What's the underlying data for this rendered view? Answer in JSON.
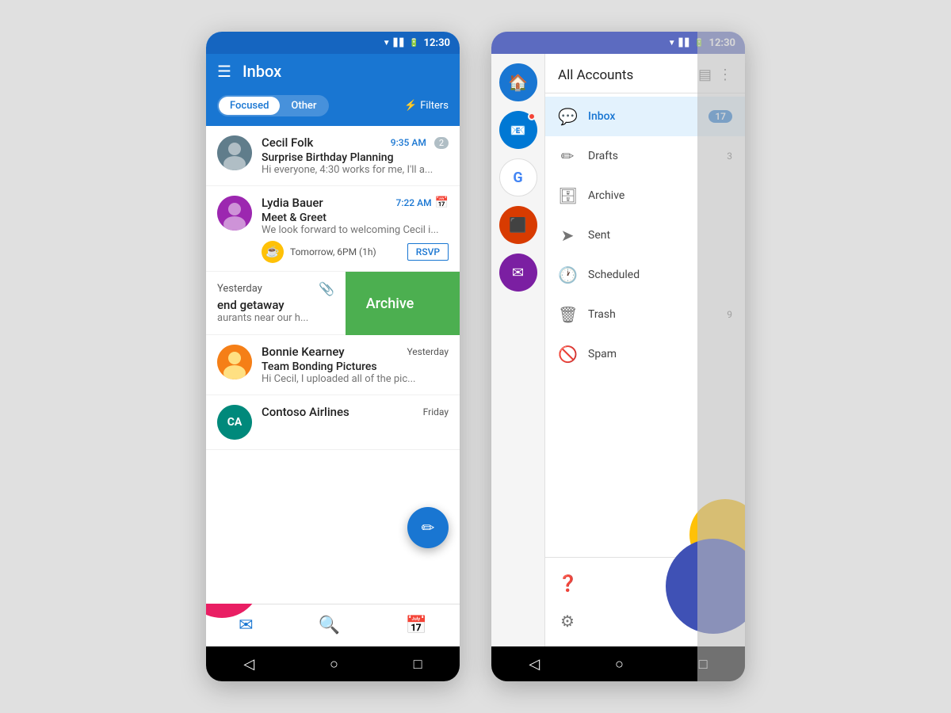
{
  "left_phone": {
    "status_bar": {
      "time": "12:30",
      "bg": "#1565C0"
    },
    "header": {
      "title": "Inbox",
      "hamburger": "☰"
    },
    "tabs": {
      "focused": "Focused",
      "other": "Other",
      "filters": "Filters"
    },
    "emails": [
      {
        "id": "email-1",
        "sender": "Cecil Folk",
        "subject": "Surprise Birthday Planning",
        "preview": "Hi everyone, 4:30 works for me, I'll a...",
        "time": "9:35 AM",
        "badge": "2",
        "avatar_color": "#607D8B",
        "has_event": false
      },
      {
        "id": "email-2",
        "sender": "Lydia Bauer",
        "subject": "Meet & Greet",
        "preview": "We look forward to welcoming Cecil i...",
        "time": "7:22 AM",
        "avatar_color": "#9C27B0",
        "has_event": true,
        "event_time": "Tomorrow, 6PM (1h)",
        "event_action": "RSVP"
      }
    ],
    "archive_item": {
      "time": "Yesterday",
      "preview": "end getaway",
      "preview2": "aurants near our h...",
      "archive_label": "Archive"
    },
    "bonnie_email": {
      "sender": "Bonnie Kearney",
      "subject": "Team Bonding Pictures",
      "preview": "Hi Cecil, I uploaded all of the pic...",
      "time": "Yesterday",
      "avatar_color": "#F57F17"
    },
    "contoso_email": {
      "sender": "Contoso Airlines",
      "time": "Friday",
      "avatar_color": "#00897B"
    },
    "nav": {
      "mail": "✉",
      "search": "🔍",
      "calendar": "📅"
    },
    "fab_icon": "✎",
    "android_nav": [
      "◁",
      "○",
      "□"
    ]
  },
  "right_phone": {
    "status_bar": {
      "time": "12:30"
    },
    "header": {
      "all_accounts": "All Accounts"
    },
    "accounts": [
      {
        "id": "home",
        "icon": "🏠",
        "color": "#fff",
        "bg": "#1976D2",
        "selected": true
      },
      {
        "id": "outlook",
        "icon": "📧",
        "color": "#fff",
        "bg": "#0078D4",
        "has_dot": true
      },
      {
        "id": "google",
        "icon": "G",
        "color": "#4285F4",
        "bg": "#fff"
      },
      {
        "id": "office",
        "icon": "⬛",
        "color": "#fff",
        "bg": "#D83B01"
      },
      {
        "id": "mail2",
        "icon": "✉",
        "color": "#fff",
        "bg": "#7B1FA2"
      }
    ],
    "menu_items": [
      {
        "id": "inbox",
        "icon": "💬",
        "label": "Inbox",
        "count": "17",
        "active": true
      },
      {
        "id": "drafts",
        "icon": "✏",
        "label": "Drafts",
        "count": "3",
        "active": false
      },
      {
        "id": "archive",
        "icon": "🗄",
        "label": "Archive",
        "count": "",
        "active": false
      },
      {
        "id": "sent",
        "icon": "➤",
        "label": "Sent",
        "count": "",
        "active": false
      },
      {
        "id": "scheduled",
        "icon": "🕐",
        "label": "Scheduled",
        "count": "",
        "active": false
      },
      {
        "id": "trash",
        "icon": "🗑",
        "label": "Trash",
        "count": "9",
        "active": false
      },
      {
        "id": "spam",
        "icon": "🚫",
        "label": "Spam",
        "count": "",
        "active": false
      }
    ],
    "footer_items": [
      {
        "id": "help",
        "icon": "❓",
        "label": "Help"
      },
      {
        "id": "settings",
        "icon": "⚙",
        "label": "Settings"
      }
    ],
    "android_nav": [
      "◁",
      "○",
      "□"
    ]
  }
}
